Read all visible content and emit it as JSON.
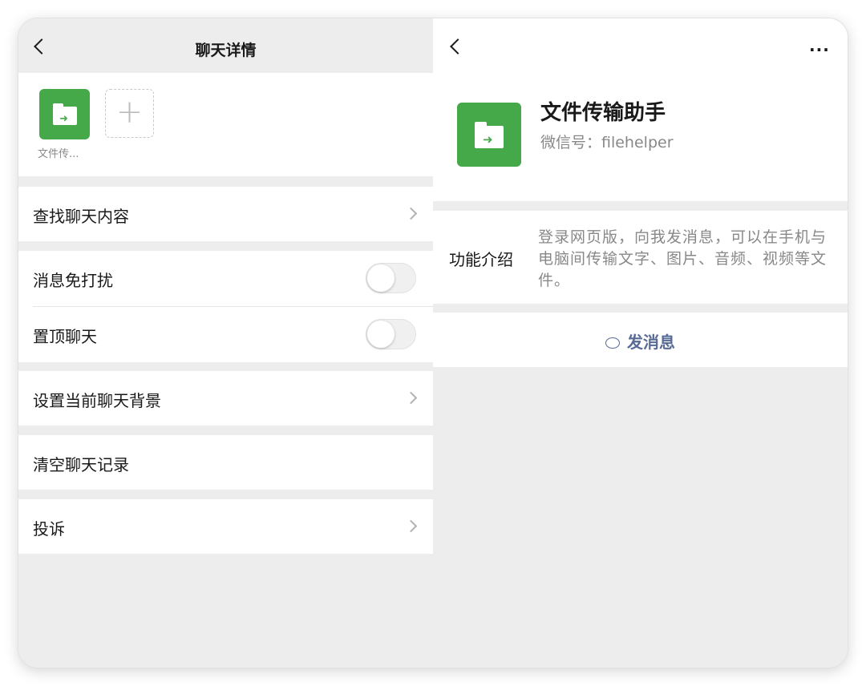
{
  "left_pane": {
    "title": "聊天详情",
    "member": {
      "name": "文件传...",
      "add_label": "+"
    },
    "items": {
      "search_history": "查找聊天内容",
      "mute": "消息免打扰",
      "sticky": "置顶聊天",
      "background": "设置当前聊天背景",
      "clear_history": "清空聊天记录",
      "report": "投诉"
    },
    "toggles": {
      "mute_on": false,
      "sticky_on": false
    }
  },
  "right_pane": {
    "more_label": "···",
    "name": "文件传输助手",
    "wechat_id": "微信号：filehelper",
    "intro_label": "功能介绍",
    "intro_text": "登录网页版，向我发消息，可以在手机与电脑间传输文字、图片、音频、视频等文件。",
    "send_label": "发消息"
  },
  "colors": {
    "brand_green": "#45a849",
    "link_blue": "#576b95",
    "background": "#ededed"
  }
}
